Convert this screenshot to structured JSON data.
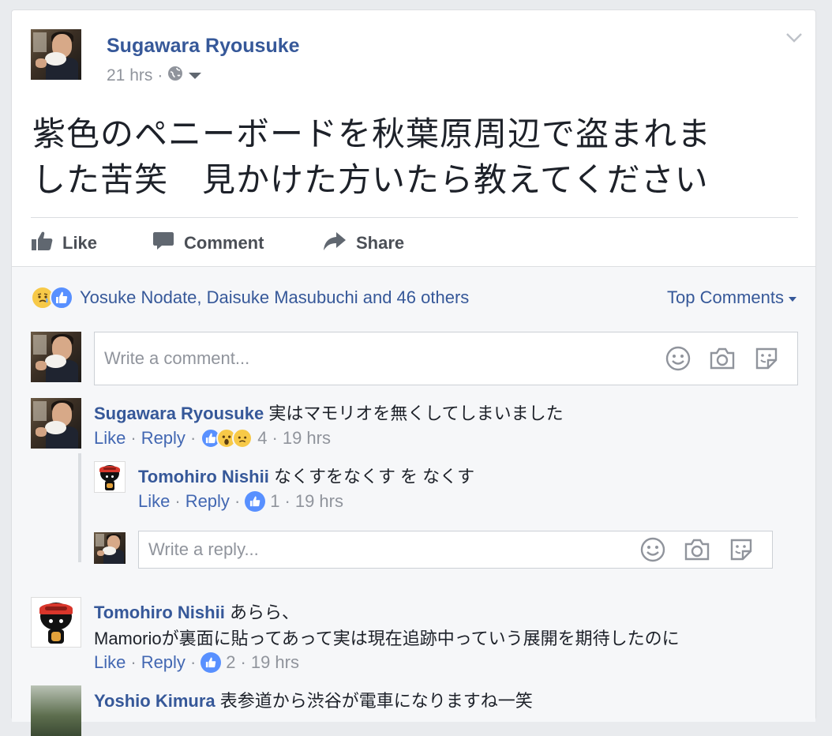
{
  "post": {
    "author": "Sugawara Ryousuke",
    "time": "21 hrs",
    "dot": "·",
    "text_line1": "紫色のペニーボードを秋葉原周辺で盗まれま",
    "text_line2": "した苦笑　見かけた方いたら教えてください"
  },
  "actions": {
    "like": "Like",
    "comment": "Comment",
    "share": "Share"
  },
  "reactions": {
    "summary": "Yosuke Nodate, Daisuke Masubuchi and 46 others",
    "sort_label": "Top Comments"
  },
  "comment_input": {
    "placeholder": "Write a comment..."
  },
  "reply_input": {
    "placeholder": "Write a reply..."
  },
  "comments": [
    {
      "author": "Sugawara Ryousuke",
      "text": "実はマモリオを無くしてしまいました",
      "like": "Like",
      "reply": "Reply",
      "count": "4",
      "time": "19 hrs"
    },
    {
      "author": "Tomohiro Nishii",
      "text": "なくすをなくす を なくす",
      "like": "Like",
      "reply": "Reply",
      "count": "1",
      "time": "19 hrs"
    },
    {
      "author": "Tomohiro Nishii",
      "text": "あらら、",
      "text2": "Mamorioが裏面に貼ってあって実は現在追跡中っていう展開を期待したのに",
      "like": "Like",
      "reply": "Reply",
      "count": "2",
      "time": "19 hrs"
    },
    {
      "author": "Yoshio Kimura",
      "text": "表参道から渋谷が電車になりますね一笑"
    }
  ],
  "colors": {
    "link": "#365899",
    "accent": "#4267b2",
    "like_blue": "#5890ff",
    "meta_gray": "#90949c"
  }
}
